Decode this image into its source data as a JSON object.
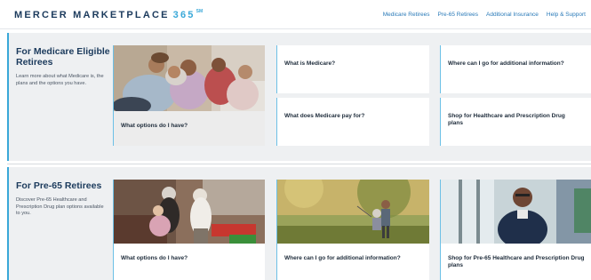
{
  "header": {
    "logo_text": "MERCER MARKETPLACE",
    "logo_num": "365",
    "logo_sup": "SM",
    "nav": [
      "Medicare Retirees",
      "Pre-65 Retirees",
      "Additional Insurance",
      "Help & Support"
    ]
  },
  "medicare": {
    "title": "For Medicare Eligible Retirees",
    "description": "Learn more about what Medicare is, the plans and the options you have.",
    "feature_card": "What options do I have?",
    "cards": [
      "What is Medicare?",
      "Where can I go for additional information?",
      "What does Medicare pay for?",
      "Shop for Healthcare and Prescription Drug plans"
    ]
  },
  "pre65": {
    "title": "For Pre-65 Retirees",
    "description": "Discover Pre-65 Healthcare and Prescription Drug plan options available to you.",
    "cards": [
      "What options do I have?",
      "Where can I go for additional information?",
      "Shop for Pre-65 Healthcare and Prescription Drug plans"
    ]
  },
  "colors": {
    "accent": "#3aa8d8",
    "navy": "#1b3a5c",
    "link": "#2a7ab8",
    "panel": "#eef0f2"
  },
  "icons": [
    "family-photo",
    "grandparent-photo",
    "park-walk-photo",
    "retiree-portrait-photo"
  ]
}
